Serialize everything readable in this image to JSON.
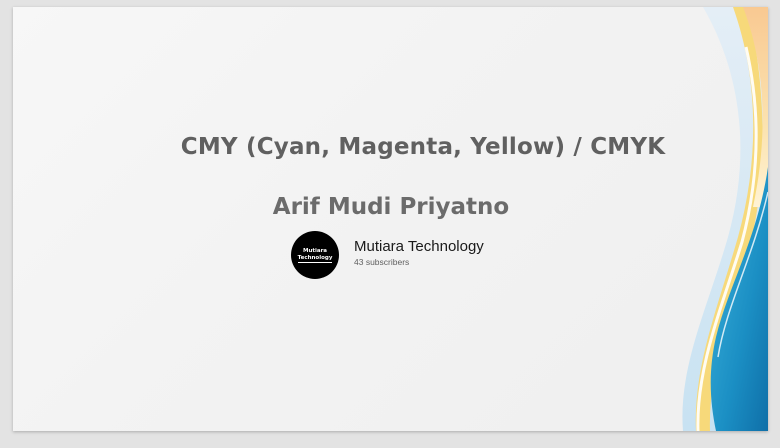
{
  "slide": {
    "title": "CMY (Cyan, Magenta, Yellow) / CMYK",
    "author": "Arif Mudi Priyatno"
  },
  "channel": {
    "avatar_line1": "Mutiara",
    "avatar_line2": "Technology",
    "name": "Mutiara Technology",
    "subscribers": "43 subscribers"
  },
  "colors": {
    "title": "#606060",
    "wave_blue": "#1e8fc4",
    "wave_yellow": "#f6d56a",
    "wave_orange": "#f7c98a"
  }
}
